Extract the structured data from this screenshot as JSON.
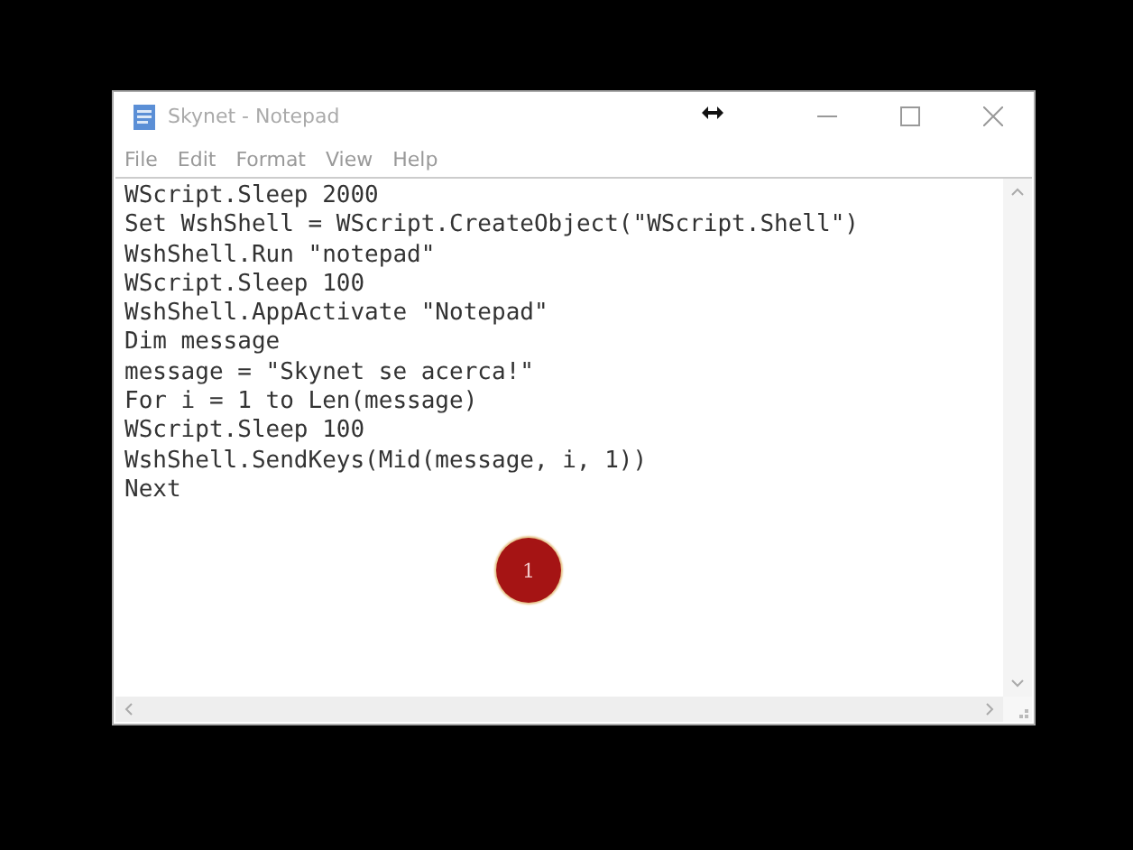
{
  "window": {
    "title": "Skynet - Notepad"
  },
  "menu": [
    "File",
    "Edit",
    "Format",
    "View",
    "Help"
  ],
  "lines": [
    "WScript.Sleep 2000",
    "Set WshShell = WScript.CreateObject(\"WScript.Shell\")",
    "WshShell.Run \"notepad\"",
    "WScript.Sleep 100",
    "WshShell.AppActivate \"Notepad\"",
    "Dim message",
    "message = \"Skynet se acerca!\"",
    "For i = 1 to Len(message)",
    "WScript.Sleep 100",
    "WshShell.SendKeys(Mid(message, i, 1))",
    "Next"
  ],
  "click_marker": {
    "label": "1"
  }
}
